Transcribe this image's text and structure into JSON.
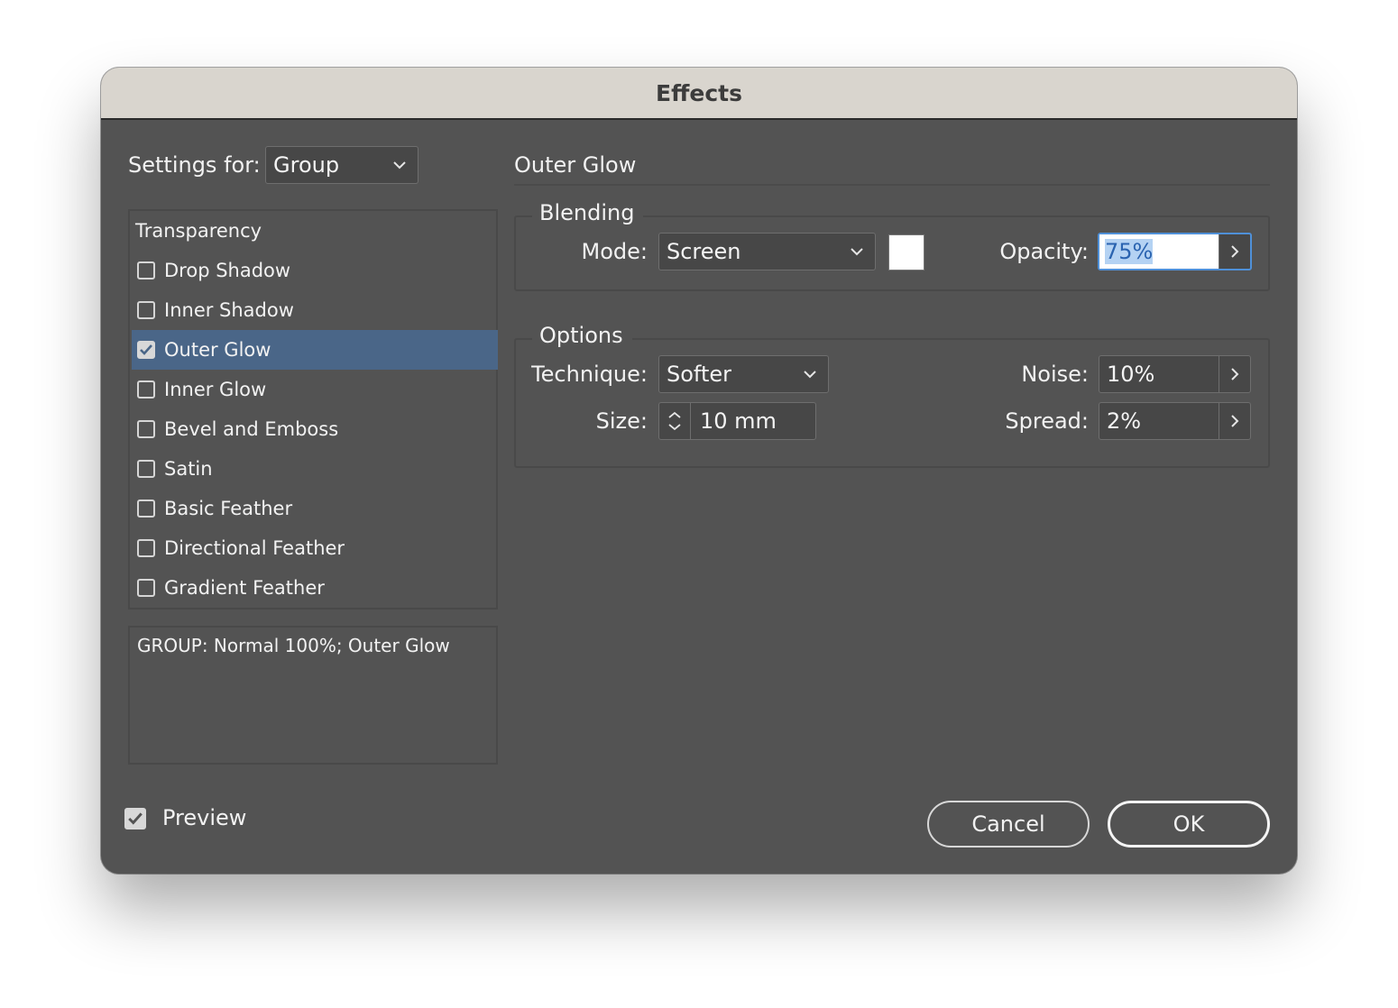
{
  "window": {
    "title": "Effects"
  },
  "settings_for": {
    "label": "Settings for:",
    "value": "Group"
  },
  "effects_list": {
    "header": "Transparency",
    "items": [
      {
        "label": "Drop Shadow",
        "checked": false
      },
      {
        "label": "Inner Shadow",
        "checked": false
      },
      {
        "label": "Outer Glow",
        "checked": true,
        "selected": true
      },
      {
        "label": "Inner Glow",
        "checked": false
      },
      {
        "label": "Bevel and Emboss",
        "checked": false
      },
      {
        "label": "Satin",
        "checked": false
      },
      {
        "label": "Basic Feather",
        "checked": false
      },
      {
        "label": "Directional Feather",
        "checked": false
      },
      {
        "label": "Gradient Feather",
        "checked": false
      }
    ]
  },
  "summary": {
    "text": "GROUP: Normal 100%; Outer Glow"
  },
  "preview": {
    "label": "Preview",
    "checked": true
  },
  "section": {
    "title": "Outer Glow"
  },
  "blending": {
    "legend": "Blending",
    "mode_label": "Mode:",
    "mode_value": "Screen",
    "color": "#ffffff",
    "opacity_label": "Opacity:",
    "opacity_value": "75%"
  },
  "options": {
    "legend": "Options",
    "technique_label": "Technique:",
    "technique_value": "Softer",
    "size_label": "Size:",
    "size_value": "10 mm",
    "noise_label": "Noise:",
    "noise_value": "10%",
    "spread_label": "Spread:",
    "spread_value": "2%"
  },
  "buttons": {
    "cancel": "Cancel",
    "ok": "OK"
  },
  "colors": {
    "selection": "#4a6688",
    "focus": "#4f90d8",
    "background": "#535353"
  }
}
